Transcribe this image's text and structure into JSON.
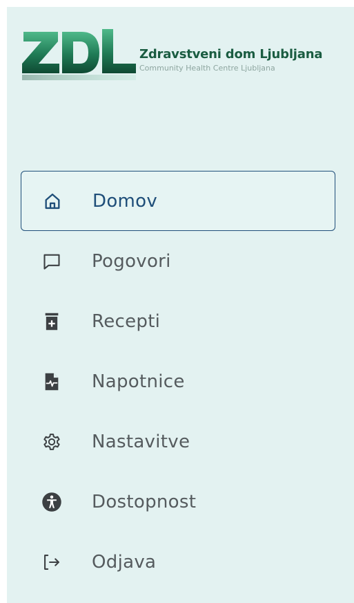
{
  "brand": {
    "logo_letters": "ZDL",
    "name": "Zdravstveni dom Ljubljana",
    "subtitle": "Community Health Centre Ljubljana"
  },
  "colors": {
    "panel_background": "#e3f2f1",
    "active_border": "#1f4e79",
    "active_text": "#1f4e79",
    "item_text": "#555b5e",
    "brand_green": "#1a5c41"
  },
  "nav": {
    "items": [
      {
        "label": "Domov",
        "icon": "home-icon",
        "active": true
      },
      {
        "label": "Pogovori",
        "icon": "chat-bubble-icon",
        "active": false
      },
      {
        "label": "Recepti",
        "icon": "medicine-bottle-icon",
        "active": false
      },
      {
        "label": "Napotnice",
        "icon": "medical-document-icon",
        "active": false
      },
      {
        "label": "Nastavitve",
        "icon": "gear-icon",
        "active": false
      },
      {
        "label": "Dostopnost",
        "icon": "accessibility-icon",
        "active": false
      },
      {
        "label": "Odjava",
        "icon": "logout-icon",
        "active": false
      }
    ]
  }
}
